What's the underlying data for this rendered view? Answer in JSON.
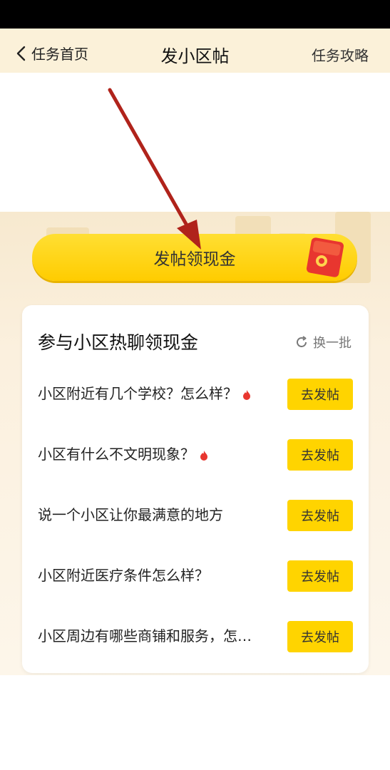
{
  "nav": {
    "back_label": "任务首页",
    "title": "发小区帖",
    "right_label": "任务攻略"
  },
  "cta": {
    "label": "发帖领现金"
  },
  "card": {
    "title": "参与小区热聊领现金",
    "refresh_label": "换一批",
    "items": [
      {
        "text": "小区附近有几个学校？怎么样？",
        "hot": true,
        "button": "去发帖"
      },
      {
        "text": "小区有什么不文明现象？",
        "hot": true,
        "button": "去发帖"
      },
      {
        "text": "说一个小区让你最满意的地方",
        "hot": false,
        "button": "去发帖"
      },
      {
        "text": "小区附近医疗条件怎么样？",
        "hot": false,
        "button": "去发帖"
      },
      {
        "text": "小区周边有哪些商铺和服务，怎…",
        "hot": false,
        "button": "去发帖"
      }
    ]
  },
  "colors": {
    "accent": "#ffd400",
    "hot": "#e8362f",
    "arrow": "#b0231b"
  }
}
